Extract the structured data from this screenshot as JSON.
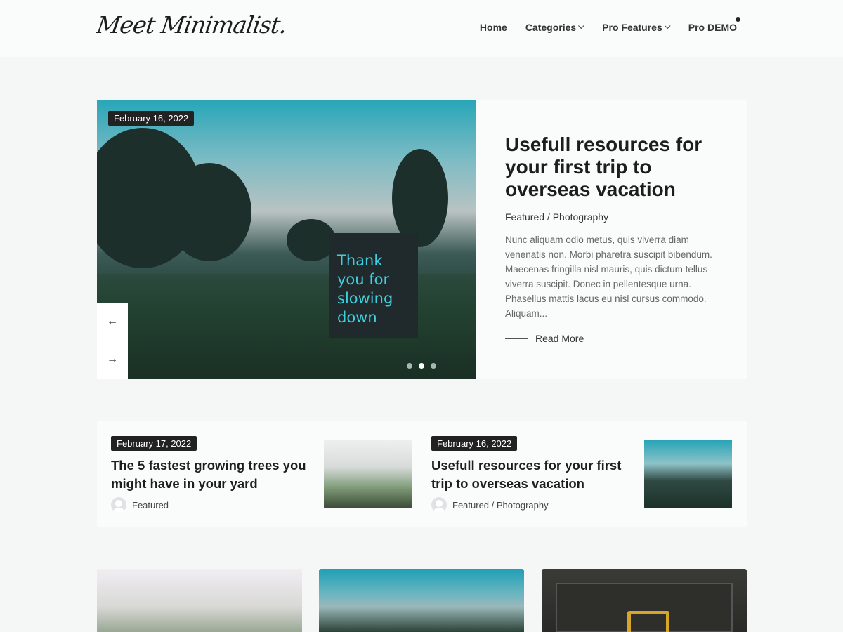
{
  "site": {
    "logo_text": "Meet Minimalist."
  },
  "nav": {
    "items": [
      {
        "label": "Home",
        "dropdown": false
      },
      {
        "label": "Categories",
        "dropdown": true
      },
      {
        "label": "Pro Features",
        "dropdown": true
      },
      {
        "label": "Pro DEMO",
        "dropdown": false
      }
    ]
  },
  "hero": {
    "date": "February 16, 2022",
    "image_sign_text": "Thank you for slowing down",
    "title": "Usefull resources for your first trip to overseas vacation",
    "categories": "Featured / Photography",
    "excerpt": "Nunc aliquam odio metus, quis viverra diam venenatis non. Morbi pharetra suscipit bibendum. Maecenas fringilla nisl mauris, quis dictum tellus viverra suscipit. Donec in pellentesque urna. Phasellus mattis lacus eu nisl cursus commodo. Aliquam...",
    "read_more": "Read More",
    "prev_icon": "arrow-left-icon",
    "next_icon": "arrow-right-icon",
    "slides": 3,
    "active_slide": 2
  },
  "featured_posts": [
    {
      "date": "February 17, 2022",
      "title": "The 5 fastest growing trees you might have in your yard",
      "categories": "Featured"
    },
    {
      "date": "February 16, 2022",
      "title": "Usefull resources for your first trip to overseas vacation",
      "categories": "Featured / Photography"
    }
  ],
  "colors": {
    "background": "#f5f7f7",
    "card": "#fafbfb",
    "badge": "#222222",
    "sign_text": "#3fd0e0"
  }
}
